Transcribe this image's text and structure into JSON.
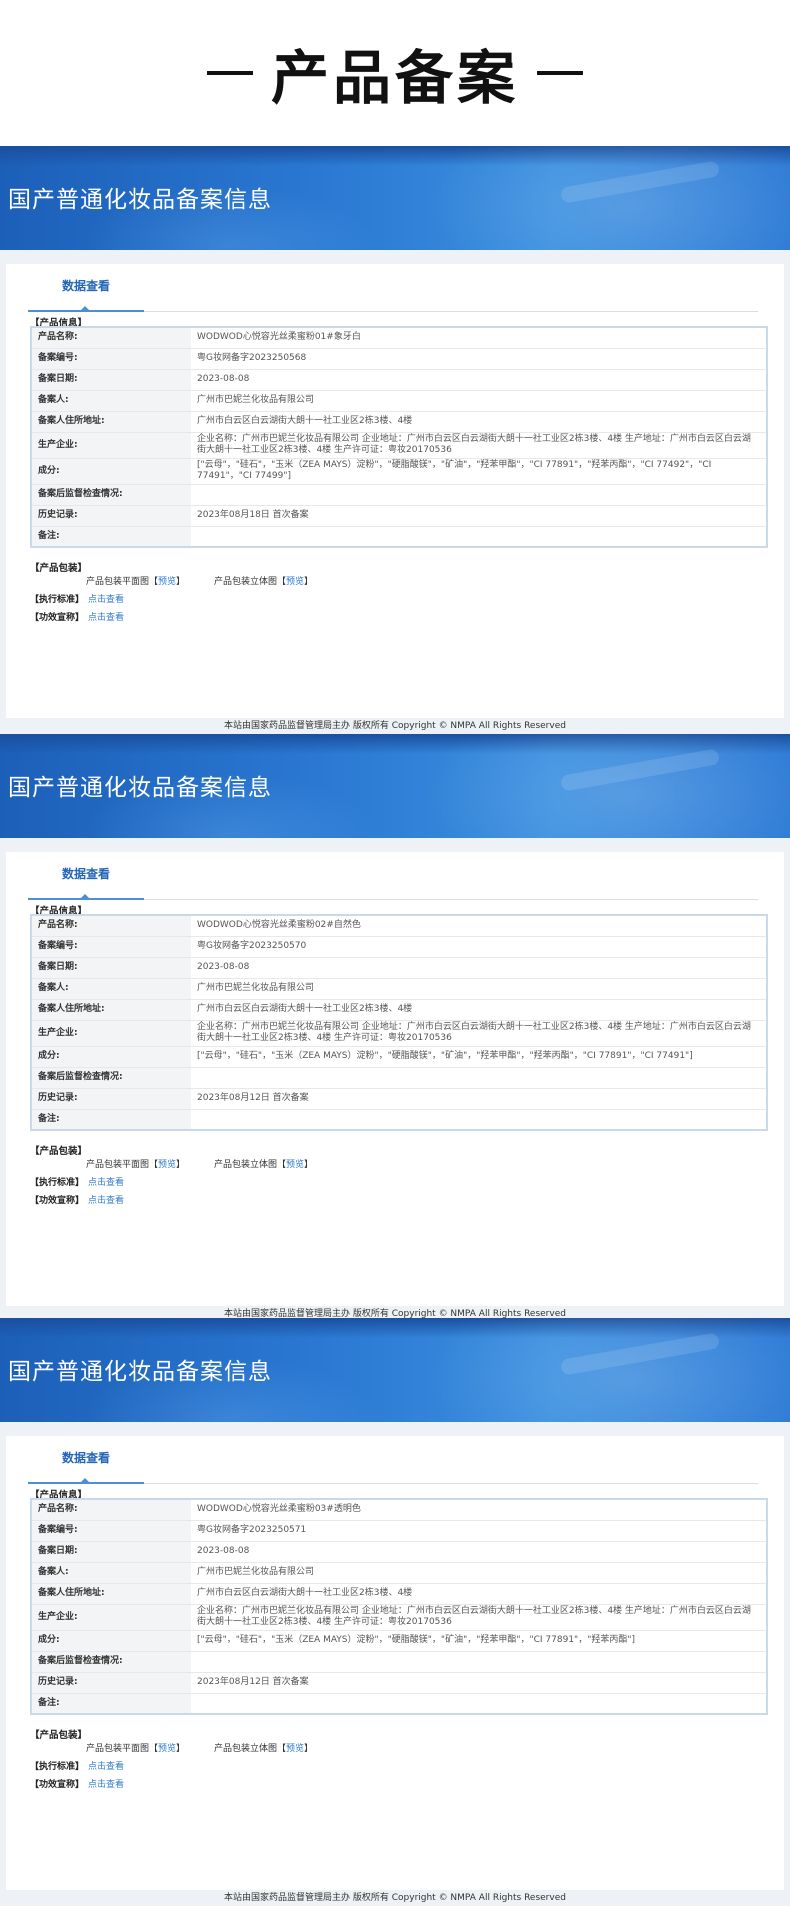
{
  "page_heading": {
    "dash_left": "—",
    "title": "产品备案",
    "dash_right": "—"
  },
  "banner_title": "国产普通化妆品备案信息",
  "tab_label": "数据查看",
  "section_product_info": "【产品信息】",
  "section_packaging": "【产品包装】",
  "field_labels": {
    "name": "产品名称:",
    "reg_no": "备案编号:",
    "date": "备案日期:",
    "registrant": "备案人:",
    "address": "备案人住所地址:",
    "producer": "生产企业:",
    "ingredients": "成分:",
    "inspection": "备案后监督检查情况:",
    "history": "历史记录:",
    "remark": "备注:"
  },
  "pkg_flat_label": "产品包装平面图",
  "pkg_3d_label": "产品包装立体图",
  "preview_label": "预览",
  "bracket_open": "【",
  "bracket_close": "】",
  "exec_std_label": "【执行标准】",
  "efficacy_label": "【功效宣称】",
  "click_view": "点击查看",
  "footer_text": "本站由国家药品监督管理局主办 版权所有 Copyright © NMPA All Rights Reserved",
  "records": [
    {
      "name": "WODWOD心悦容光丝柔蜜粉01#象牙白",
      "reg_no": "粤G妆网备字2023250568",
      "date": "2023-08-08",
      "registrant": "广州市巴妮兰化妆品有限公司",
      "address": "广州市白云区白云湖街大朗十一社工业区2栋3楼、4楼",
      "producer": "企业名称：广州市巴妮兰化妆品有限公司 企业地址：广州市白云区白云湖街大朗十一社工业区2栋3楼、4楼 生产地址：广州市白云区白云湖街大朗十一社工业区2栋3楼、4楼 生产许可证：粤妆20170536",
      "ingredients": "[\"云母\"，\"硅石\"，\"玉米（ZEA MAYS）淀粉\"，\"硬脂酸镁\"，\"矿油\"，\"羟苯甲酯\"，\"CI 77891\"，\"羟苯丙酯\"，\"CI 77492\"，\"CI 77491\"，\"CI 77499\"]",
      "inspection": "",
      "history": "2023年08月18日 首次备案",
      "remark": ""
    },
    {
      "name": "WODWOD心悦容光丝柔蜜粉02#自然色",
      "reg_no": "粤G妆网备字2023250570",
      "date": "2023-08-08",
      "registrant": "广州市巴妮兰化妆品有限公司",
      "address": "广州市白云区白云湖街大朗十一社工业区2栋3楼、4楼",
      "producer": "企业名称：广州市巴妮兰化妆品有限公司 企业地址：广州市白云区白云湖街大朗十一社工业区2栋3楼、4楼 生产地址：广州市白云区白云湖街大朗十一社工业区2栋3楼、4楼 生产许可证：粤妆20170536",
      "ingredients": "[\"云母\"，\"硅石\"，\"玉米（ZEA MAYS）淀粉\"，\"硬脂酸镁\"，\"矿油\"，\"羟苯甲酯\"，\"羟苯丙酯\"，\"CI 77891\"，\"CI 77491\"]",
      "inspection": "",
      "history": "2023年08月12日 首次备案",
      "remark": ""
    },
    {
      "name": "WODWOD心悦容光丝柔蜜粉03#透明色",
      "reg_no": "粤G妆网备字2023250571",
      "date": "2023-08-08",
      "registrant": "广州市巴妮兰化妆品有限公司",
      "address": "广州市白云区白云湖街大朗十一社工业区2栋3楼、4楼",
      "producer": "企业名称：广州市巴妮兰化妆品有限公司 企业地址：广州市白云区白云湖街大朗十一社工业区2栋3楼、4楼 生产地址：广州市白云区白云湖街大朗十一社工业区2栋3楼、4楼 生产许可证：粤妆20170536",
      "ingredients": "[\"云母\"，\"硅石\"，\"玉米（ZEA MAYS）淀粉\"，\"硬脂酸镁\"，\"矿油\"，\"羟苯甲酯\"，\"CI 77891\"，\"羟苯丙酯\"]",
      "inspection": "",
      "history": "2023年08月12日 首次备案",
      "remark": ""
    }
  ]
}
